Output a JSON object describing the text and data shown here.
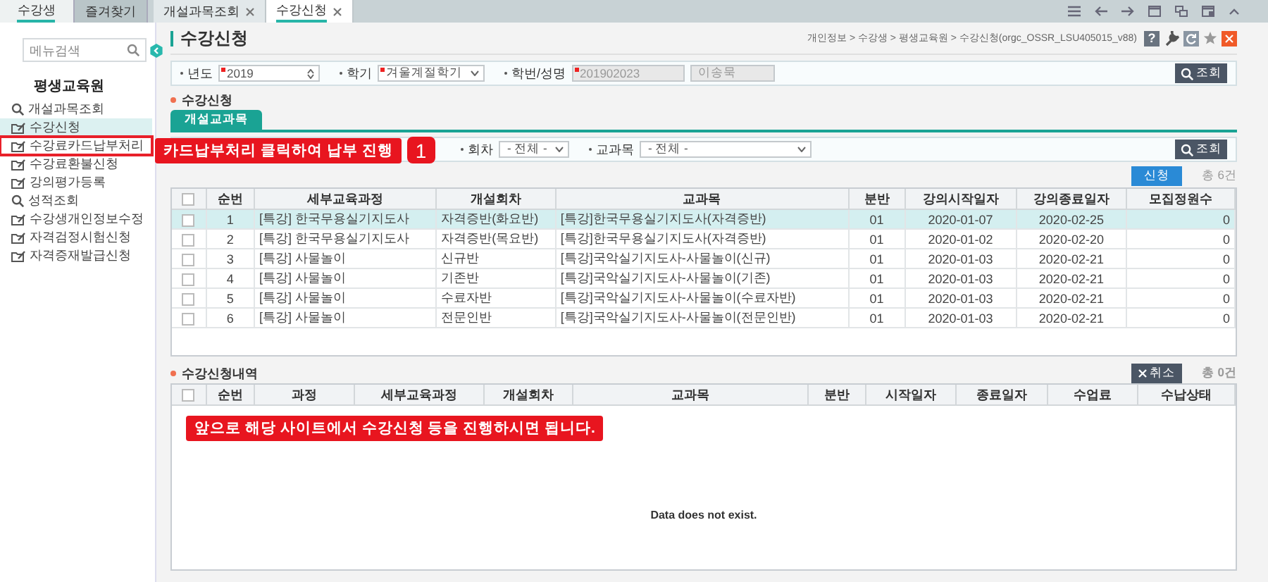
{
  "sidebar_tabs": [
    {
      "label": "수강생",
      "selected": true
    },
    {
      "label": "즐겨찾기",
      "selected": false
    }
  ],
  "tabs": [
    {
      "label": "개설과목조회",
      "selected": false
    },
    {
      "label": "수강신청",
      "selected": true
    }
  ],
  "sidebar": {
    "search": {
      "placeholder": "메뉴검색"
    },
    "title": "평생교육원",
    "items": [
      {
        "label": "개설과목조회",
        "kind": "search",
        "selected": false,
        "highlighted": false
      },
      {
        "label": "수강신청",
        "kind": "page",
        "selected": true,
        "highlighted": false
      },
      {
        "label": "수강료카드납부처리",
        "kind": "page",
        "selected": false,
        "highlighted": true
      },
      {
        "label": "수강료환불신청",
        "kind": "page",
        "selected": false,
        "highlighted": false
      },
      {
        "label": "강의평가등록",
        "kind": "page",
        "selected": false,
        "highlighted": false
      },
      {
        "label": "성적조회",
        "kind": "search",
        "selected": false,
        "highlighted": false
      },
      {
        "label": "수강생개인정보수정",
        "kind": "page",
        "selected": false,
        "highlighted": false
      },
      {
        "label": "자격검정시험신청",
        "kind": "page",
        "selected": false,
        "highlighted": false
      },
      {
        "label": "자격증재발급신청",
        "kind": "page",
        "selected": false,
        "highlighted": false
      }
    ]
  },
  "page": {
    "title": "수강신청",
    "breadcrumb": "개인정보 > 수강생 > 평생교육원 > 수강신청(orgc_OSSR_LSU405015_v88)",
    "help": "?"
  },
  "filters": [
    {
      "label": "년도",
      "kind": "spin",
      "required": true,
      "values": [
        "2019"
      ]
    },
    {
      "label": "학기",
      "kind": "select",
      "required": true,
      "values": [
        "겨울계절학기"
      ]
    },
    {
      "label": "학번/성명",
      "kind": "readonly",
      "required": true,
      "values": [
        "201902023",
        "이송묵"
      ]
    }
  ],
  "search_button": "조회",
  "section1": {
    "title": "수강신청",
    "subtabs": [
      {
        "label": "개설교과목",
        "selected": true
      }
    ],
    "filters": [
      {
        "label": "회차",
        "value": "- 전체 -"
      },
      {
        "label": "교과목",
        "value": "- 전체 -"
      }
    ],
    "search_button": "조회",
    "apply_button": "신청",
    "count": "총 6건",
    "table": {
      "all_checked": false,
      "columns": [
        "순번",
        "세부교육과정",
        "개설회차",
        "교과목",
        "분반",
        "강의시작일자",
        "강의종료일자",
        "모집정원수"
      ],
      "rows": [
        {
          "selected": true,
          "checked": false,
          "cells": [
            "1",
            "[특강] 한국무용실기지도사",
            "자격증반(화요반)",
            "[특강]한국무용실기지도사(자격증반)",
            "01",
            "2020-01-07",
            "2020-02-25",
            "0"
          ]
        },
        {
          "selected": false,
          "checked": false,
          "cells": [
            "2",
            "[특강] 한국무용실기지도사",
            "자격증반(목요반)",
            "[특강]한국무용실기지도사(자격증반)",
            "01",
            "2020-01-02",
            "2020-02-20",
            "0"
          ]
        },
        {
          "selected": false,
          "checked": false,
          "cells": [
            "3",
            "[특강] 사물놀이",
            "신규반",
            "[특강]국악실기지도사-사물놀이(신규)",
            "01",
            "2020-01-03",
            "2020-02-21",
            "0"
          ]
        },
        {
          "selected": false,
          "checked": false,
          "cells": [
            "4",
            "[특강] 사물놀이",
            "기존반",
            "[특강]국악실기지도사-사물놀이(기존)",
            "01",
            "2020-01-03",
            "2020-02-21",
            "0"
          ]
        },
        {
          "selected": false,
          "checked": false,
          "cells": [
            "5",
            "[특강] 사물놀이",
            "수료자반",
            "[특강]국악실기지도사-사물놀이(수료자반)",
            "01",
            "2020-01-03",
            "2020-02-21",
            "0"
          ]
        },
        {
          "selected": false,
          "checked": false,
          "cells": [
            "6",
            "[특강] 사물놀이",
            "전문인반",
            "[특강]국악실기지도사-사물놀이(전문인반)",
            "01",
            "2020-01-03",
            "2020-02-21",
            "0"
          ]
        }
      ]
    }
  },
  "section2": {
    "title": "수강신청내역",
    "cancel_button": "취소",
    "count": "총 0건",
    "table": {
      "all_checked": false,
      "columns": [
        "순번",
        "과정",
        "세부교육과정",
        "개설회차",
        "교과목",
        "분반",
        "시작일자",
        "종료일자",
        "수업료",
        "수납상태"
      ],
      "empty_text": "Data does not exist."
    }
  },
  "callouts": [
    {
      "text": "카드납부처리 클릭하여 납부 진행",
      "step": "1"
    },
    {
      "text": "앞으로 해당 사이트에서 수강신청 등을 진행하시면 됩니다."
    }
  ]
}
